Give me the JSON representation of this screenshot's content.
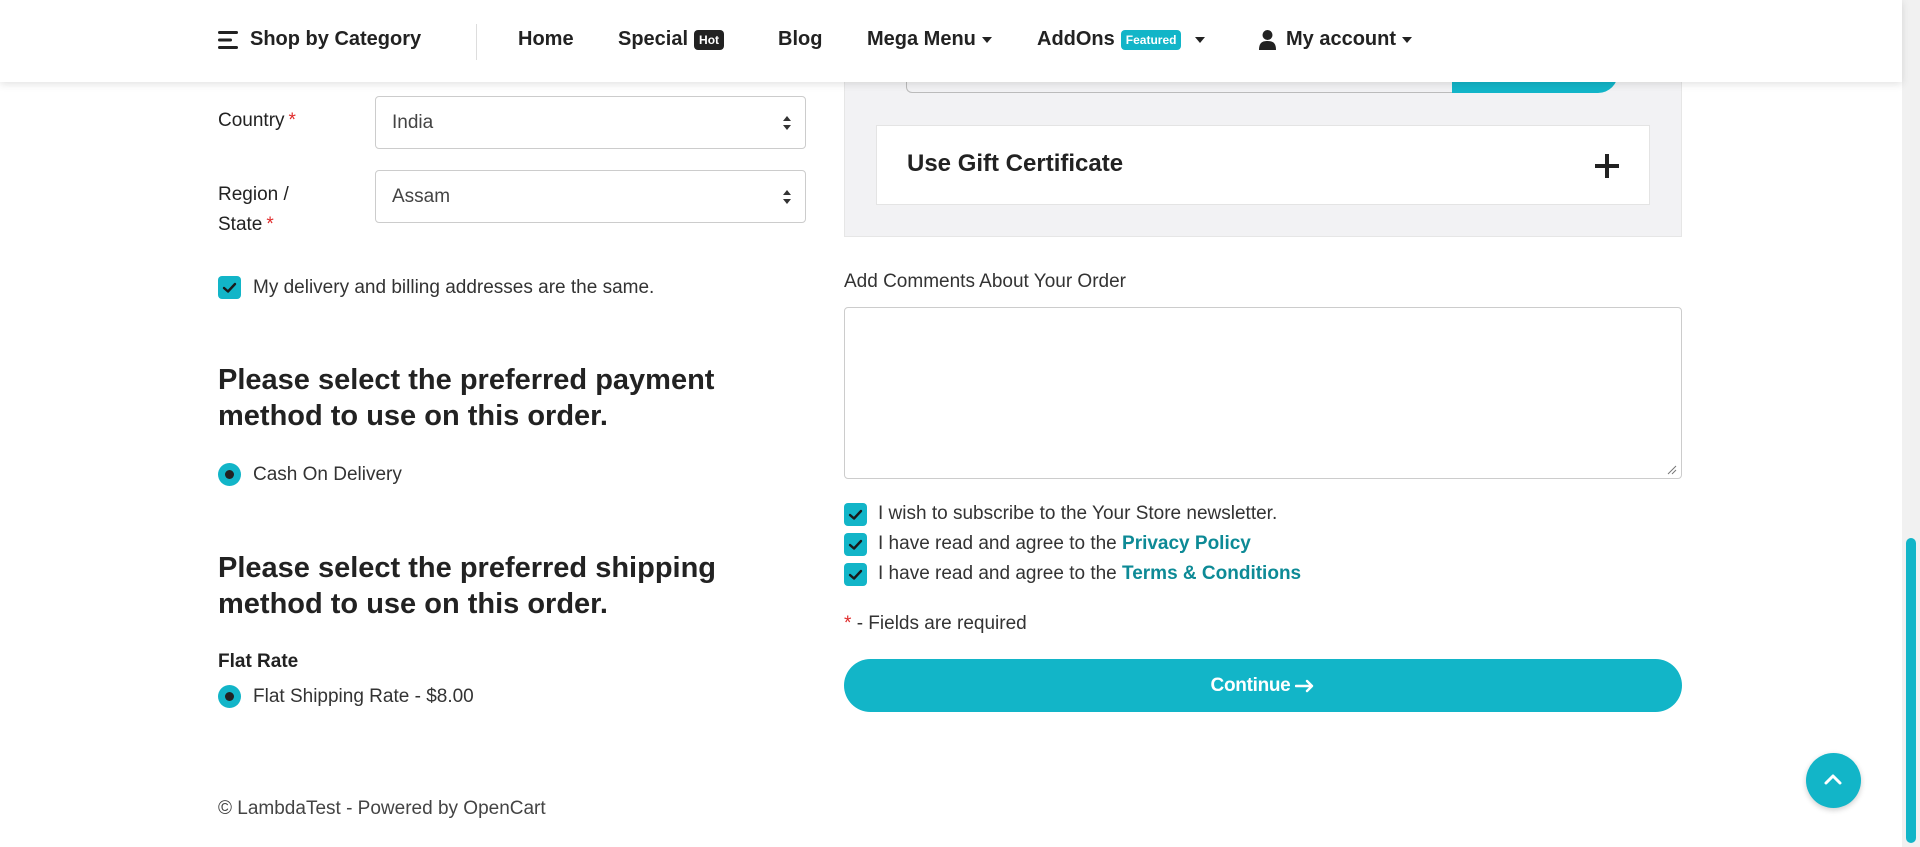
{
  "nav": {
    "shop_by_category": "Shop by Category",
    "home": "Home",
    "special": "Special",
    "special_badge": "Hot",
    "blog": "Blog",
    "mega_menu": "Mega Menu",
    "addons": "AddOns",
    "addons_badge": "Featured",
    "my_account": "My account"
  },
  "address": {
    "country_label": "Country",
    "country_value": "India",
    "region_label_line1": "Region /",
    "region_label_line2": "State",
    "region_value": "Assam",
    "required_mark": "*",
    "same_address_label": "My delivery and billing addresses are the same.",
    "same_address_checked": true
  },
  "payment": {
    "heading": "Please select the preferred payment method to use on this order.",
    "option": "Cash On Delivery"
  },
  "shipping": {
    "heading": "Please select the preferred shipping method to use on this order.",
    "group_title": "Flat Rate",
    "option": "Flat Shipping Rate - $8.00"
  },
  "right": {
    "gift_title": "Use Gift Certificate",
    "comments_label": "Add Comments About Your Order",
    "comments_value": "",
    "newsletter_label": "I wish to subscribe to the Your Store newsletter.",
    "privacy_prefix": "I have read and agree to the ",
    "privacy_link": "Privacy Policy",
    "terms_prefix": "I have read and agree to the ",
    "terms_link": "Terms & Conditions",
    "required_note": "- Fields are required",
    "continue_label": "Continue"
  },
  "footer": {
    "text": "© LambdaTest - Powered by OpenCart"
  },
  "colors": {
    "accent": "#12b5c8",
    "link": "#0d8a96",
    "required": "#e02b2b"
  }
}
